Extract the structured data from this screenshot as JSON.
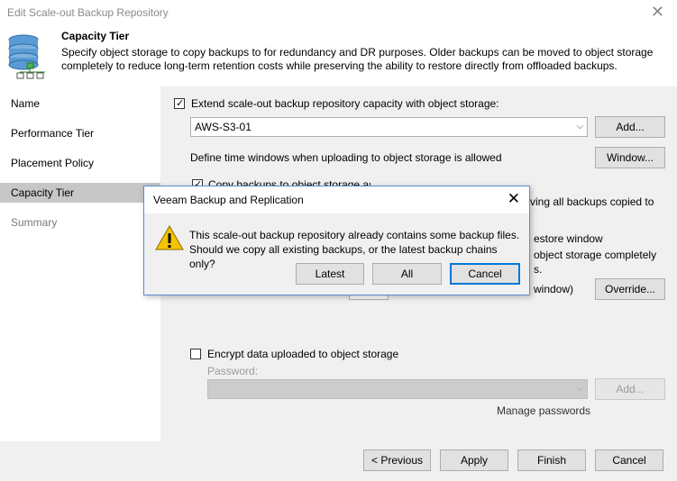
{
  "window": {
    "title": "Edit Scale-out Backup Repository",
    "close_glyph": "✕"
  },
  "header": {
    "title": "Capacity Tier",
    "description": "Specify object storage to copy backups to for redundancy and DR purposes. Older backups can be moved to object storage completely to reduce long-term retention costs while preserving the ability to restore directly from offloaded backups.",
    "icon": "repository-icon"
  },
  "sidebar": {
    "items": [
      {
        "label": "Name",
        "state": "normal"
      },
      {
        "label": "Performance Tier",
        "state": "normal"
      },
      {
        "label": "Placement Policy",
        "state": "normal"
      },
      {
        "label": "Capacity Tier",
        "state": "active"
      },
      {
        "label": "Summary",
        "state": "disabled"
      }
    ]
  },
  "capacity": {
    "extend_label": "Extend scale-out backup repository capacity with object storage:",
    "extend_checked": true,
    "storage_value": "AWS-S3-01",
    "add_button": "Add...",
    "time_window_label": "Define time windows when uploading to object storage is allowed",
    "window_button": "Window...",
    "copy_label_partial": "Copy backups to object storage as soon as they are created",
    "copy_checked": true,
    "copy_right_partial": "ving all backups copied to",
    "restore_partial": "estore window",
    "move_partial": "object storage completely",
    "move_partial2": "s.",
    "window_partial": "window)",
    "override_button": "Override...",
    "encrypt_label": "Encrypt data uploaded to object storage",
    "encrypt_checked": false,
    "password_label": "Password:",
    "password_add_button": "Add...",
    "manage_passwords": "Manage passwords"
  },
  "footer": {
    "previous": "< Previous",
    "apply": "Apply",
    "finish": "Finish",
    "cancel": "Cancel"
  },
  "dialog": {
    "title": "Veeam Backup and Replication",
    "message_line1": "This scale-out backup repository already contains some backup files.",
    "message_line2": "Should we copy all existing backups, or the latest backup chains only?",
    "latest": "Latest",
    "all": "All",
    "cancel": "Cancel",
    "close_glyph": "✕",
    "warning_glyph": "!"
  },
  "colors": {
    "accent": "#0078d7",
    "warning": "#f5c400",
    "active_nav": "#c7c7c7"
  }
}
